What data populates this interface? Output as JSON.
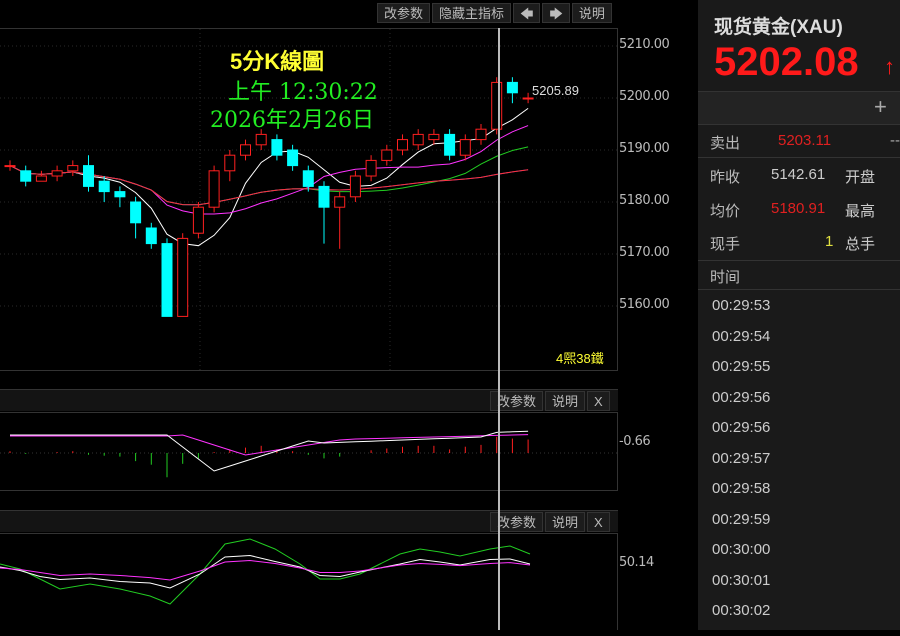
{
  "toolbar": {
    "params": "改参数",
    "hide_main": "隐藏主指标",
    "left": "🡄",
    "right": "🡆",
    "help": "说明"
  },
  "chart": {
    "title": "5分K線圖",
    "time": "上午  12:30:22",
    "date": "2026年2月26日",
    "last_label": "5205.89",
    "countdown": "4煕38鐵",
    "axis": [
      "5210.00",
      "5200.00",
      "5190.00",
      "5180.00",
      "5170.00",
      "5160.00"
    ]
  },
  "sub1": {
    "params": "改参数",
    "help": "说明",
    "close": "X",
    "value": "-0.66"
  },
  "sub2": {
    "params": "改参数",
    "help": "说明",
    "close": "X",
    "value": "50.14"
  },
  "quote": {
    "name": "现货黄金(XAU)",
    "price": "5202.08",
    "plus": "+",
    "sell_label": "卖出",
    "sell": "5203.11",
    "sell_extra": "--",
    "prev_label": "昨收",
    "prev": "5142.61",
    "open_label": "开盘",
    "avg_label": "均价",
    "avg": "5180.91",
    "high_label": "最高",
    "vol_label": "现手",
    "vol": "1",
    "total_label": "总手",
    "time_header": "时间",
    "times": [
      "00:29:53",
      "00:29:54",
      "00:29:55",
      "00:29:56",
      "00:29:56",
      "00:29:57",
      "00:29:58",
      "00:29:59",
      "00:30:00",
      "00:30:01",
      "00:30:02"
    ]
  },
  "colors": {
    "up": "#ff2020",
    "down": "#00ffff",
    "price": "#ff1a1a"
  },
  "chart_data": {
    "type": "candlestick",
    "ylim": [
      5150,
      5215
    ],
    "candles": [
      [
        5187,
        5188,
        5186,
        5187
      ],
      [
        5186,
        5187,
        5183,
        5184
      ],
      [
        5184,
        5186,
        5184,
        5185
      ],
      [
        5185,
        5187,
        5184,
        5186
      ],
      [
        5186,
        5188,
        5185,
        5187
      ],
      [
        5187,
        5189,
        5182,
        5183
      ],
      [
        5184,
        5185,
        5180,
        5182
      ],
      [
        5182,
        5183,
        5179,
        5181
      ],
      [
        5180,
        5181,
        5173,
        5176
      ],
      [
        5175,
        5176,
        5171,
        5172
      ],
      [
        5172,
        5173,
        5158,
        5158
      ],
      [
        5158,
        5174,
        5158,
        5173
      ],
      [
        5174,
        5180,
        5173,
        5179
      ],
      [
        5179,
        5187,
        5178,
        5186
      ],
      [
        5186,
        5190,
        5184,
        5189
      ],
      [
        5189,
        5192,
        5188,
        5191
      ],
      [
        5191,
        5194,
        5190,
        5193
      ],
      [
        5192,
        5193,
        5188,
        5189
      ],
      [
        5190,
        5191,
        5186,
        5187
      ],
      [
        5186,
        5187,
        5182,
        5183
      ],
      [
        5183,
        5184,
        5172,
        5179
      ],
      [
        5179,
        5182,
        5171,
        5181
      ],
      [
        5181,
        5186,
        5180,
        5185
      ],
      [
        5185,
        5189,
        5184,
        5188
      ],
      [
        5188,
        5191,
        5187,
        5190
      ],
      [
        5190,
        5193,
        5189,
        5192
      ],
      [
        5191,
        5194,
        5190,
        5193
      ],
      [
        5192,
        5194,
        5191,
        5193
      ],
      [
        5193,
        5194,
        5188,
        5189
      ],
      [
        5189,
        5193,
        5188,
        5192
      ],
      [
        5192,
        5195,
        5191,
        5194
      ],
      [
        5194,
        5204,
        5193,
        5203
      ],
      [
        5203,
        5204,
        5199,
        5201
      ],
      [
        5200,
        5201,
        5199,
        5200
      ]
    ]
  }
}
